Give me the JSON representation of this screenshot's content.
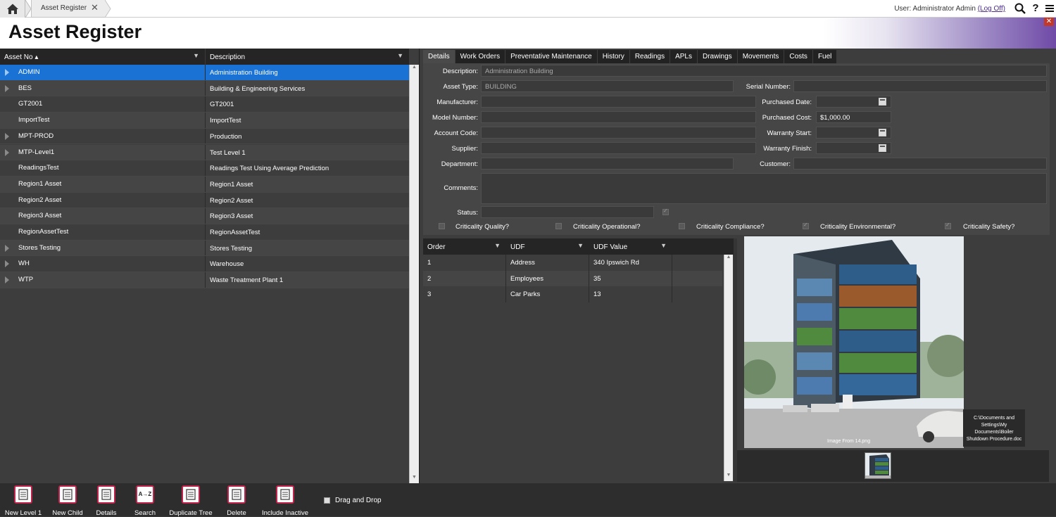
{
  "topbar": {
    "breadcrumb": "Asset Register",
    "close_glyph": "✕",
    "user_prefix": "User: Administrator Admin",
    "logoff": "(Log Off)",
    "icons": [
      "home-icon",
      "search-icon",
      "help-icon",
      "menu-icon"
    ]
  },
  "header": {
    "title": "Asset Register",
    "close_glyph": "✕"
  },
  "tree": {
    "columns": [
      "Asset No ▴",
      "Description"
    ],
    "rows": [
      {
        "asset": "ADMIN",
        "desc": "Administration Building",
        "expandable": true,
        "selected": true
      },
      {
        "asset": "BES",
        "desc": "Building & Engineering Services",
        "expandable": true
      },
      {
        "asset": "GT2001",
        "desc": "GT2001",
        "expandable": false
      },
      {
        "asset": "ImportTest",
        "desc": "ImportTest",
        "expandable": false
      },
      {
        "asset": "MPT-PROD",
        "desc": "Production",
        "expandable": true
      },
      {
        "asset": "MTP-Level1",
        "desc": "Test Level 1",
        "expandable": true
      },
      {
        "asset": "ReadingsTest",
        "desc": "Readings Test Using Average Prediction",
        "expandable": false
      },
      {
        "asset": "Region1 Asset",
        "desc": "Region1 Asset",
        "expandable": false
      },
      {
        "asset": "Region2 Asset",
        "desc": "Region2 Asset",
        "expandable": false
      },
      {
        "asset": "Region3 Asset",
        "desc": "Region3 Asset",
        "expandable": false
      },
      {
        "asset": "RegionAssetTest",
        "desc": "RegionAssetTest",
        "expandable": false
      },
      {
        "asset": "Stores Testing",
        "desc": "Stores Testing",
        "expandable": true
      },
      {
        "asset": "WH",
        "desc": "Warehouse",
        "expandable": true
      },
      {
        "asset": "WTP",
        "desc": "Waste Treatment Plant 1",
        "expandable": true
      }
    ]
  },
  "tabs": [
    "Details",
    "Work Orders",
    "Preventative Maintenance",
    "History",
    "Readings",
    "APLs",
    "Drawings",
    "Movements",
    "Costs",
    "Fuel"
  ],
  "details": {
    "description_label": "Description:",
    "description": "Administration Building",
    "asset_type_label": "Asset Type:",
    "asset_type": "BUILDING",
    "serial_label": "Serial Number:",
    "serial": "",
    "manufacturer_label": "Manufacturer:",
    "manufacturer": "",
    "purchased_date_label": "Purchased Date:",
    "purchased_date": "",
    "model_label": "Model Number:",
    "model": "",
    "purchased_cost_label": "Purchased Cost:",
    "purchased_cost": "$1,000.00",
    "account_label": "Account Code:",
    "account": "",
    "warranty_start_label": "Warranty Start:",
    "warranty_start": "",
    "supplier_label": "Supplier:",
    "supplier": "",
    "warranty_finish_label": "Warranty Finish:",
    "warranty_finish": "",
    "department_label": "Department:",
    "department": "",
    "customer_label": "Customer:",
    "customer": "",
    "comments_label": "Comments:",
    "comments": "",
    "status_label": "Status:",
    "status": "",
    "criticality": [
      {
        "label": "Criticality Quality?",
        "checked": false
      },
      {
        "label": "Criticality Operational?",
        "checked": false
      },
      {
        "label": "Criticality Compliance?",
        "checked": false
      },
      {
        "label": "Criticality Environmental?",
        "checked": true
      },
      {
        "label": "Criticality Safety?",
        "checked": true
      }
    ]
  },
  "udf": {
    "columns": [
      "Order",
      "UDF",
      "UDF Value"
    ],
    "rows": [
      {
        "order": "1",
        "udf": "Address",
        "value": "340 Ipswich Rd"
      },
      {
        "order": "2",
        "udf": "Employees",
        "value": "35"
      },
      {
        "order": "3",
        "udf": "Car Parks",
        "value": "13"
      }
    ]
  },
  "image": {
    "caption": "Image From 14.png",
    "document": "C:\\Documents and Settings\\My Documents\\Boiler Shutdown Procedure.doc"
  },
  "toolbar": {
    "buttons": [
      {
        "label": "New Level 1",
        "icon": "new-level-icon"
      },
      {
        "label": "New Child",
        "icon": "new-child-icon"
      },
      {
        "label": "Details",
        "icon": "details-icon"
      },
      {
        "label": "Search",
        "icon": "sort-search-icon",
        "glyph": "A→Z"
      },
      {
        "label": "Duplicate Tree",
        "icon": "duplicate-tree-icon"
      },
      {
        "label": "Delete",
        "icon": "delete-icon"
      },
      {
        "label": "Include Inactive",
        "icon": "include-inactive-icon"
      }
    ],
    "drag_drop_label": "Drag and Drop"
  },
  "colors": {
    "selection": "#1a73d4",
    "accent": "#c0234b",
    "header_gradient_end": "#6f4aa7"
  }
}
